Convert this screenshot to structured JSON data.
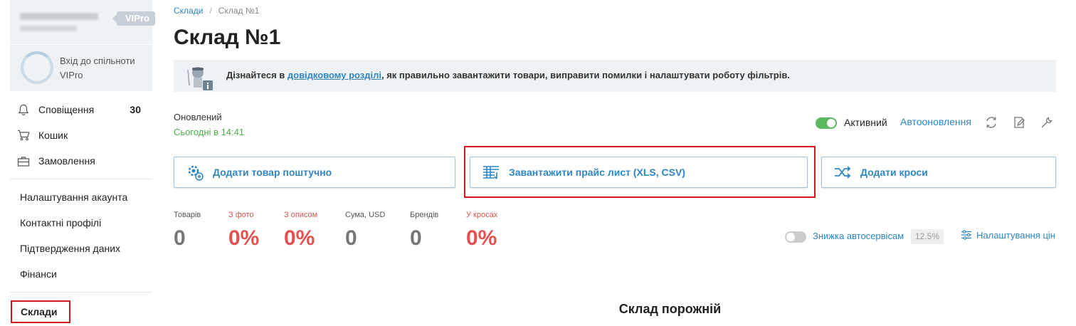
{
  "sidebar": {
    "vip_badge": "VIPro",
    "community_label": "Вхід до спільноти VIPro",
    "notifications": {
      "label": "Сповіщення",
      "count": "30"
    },
    "cart": "Кошик",
    "orders": "Замовлення",
    "account_settings": "Налаштування акаунта",
    "contact_profiles": "Контактні профілі",
    "data_confirmation": "Підтвердження даних",
    "finance": "Фінанси",
    "warehouses": "Склади"
  },
  "breadcrumb": {
    "root": "Склади",
    "current": "Склад №1"
  },
  "page_title": "Склад №1",
  "info": {
    "before": "Дізнайтеся в ",
    "link": "довідковому розділі",
    "after": ", як правильно завантажити товари, виправити помилки і налаштувати роботу фільтрів."
  },
  "updated": {
    "label": "Оновлений",
    "value": "Сьогодні в 14:41"
  },
  "status": {
    "active_label": "Активний",
    "active": true,
    "autoupdate_label": "Автооновлення"
  },
  "actions": {
    "add_item": "Додати товар поштучно",
    "upload_price": "Завантажити прайс лист (XLS, CSV)",
    "add_crosses": "Додати кроси"
  },
  "stats": [
    {
      "label": "Товарів",
      "value": "0"
    },
    {
      "label": "З фото",
      "value": "0%"
    },
    {
      "label": "З описом",
      "value": "0%"
    },
    {
      "label": "Сума, USD",
      "value": "0"
    },
    {
      "label": "Брендів",
      "value": "0"
    },
    {
      "label": "У кросах",
      "value": "0%"
    }
  ],
  "discount": {
    "label": "Знижка автосервісам",
    "value": "12.5%",
    "enabled": false
  },
  "price_settings": "Налаштування цін",
  "empty_state": "Склад порожній",
  "colors": {
    "accent": "#2f86c4",
    "highlight": "#d2171e",
    "success": "#5cb85c",
    "danger": "#e05252"
  }
}
